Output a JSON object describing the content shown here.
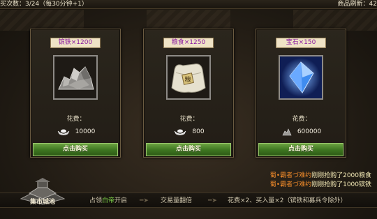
{
  "topbar": {
    "left_text": "买次数：3/24（每30分钟+1）",
    "right_text": "商品刷新：42"
  },
  "items": [
    {
      "name": "镔铁×1200",
      "image": "iron-ore-icon",
      "cost_label": "花费：",
      "currency_icon": "silver-ingot-icon",
      "price": "10000",
      "buy_label": "点击购买"
    },
    {
      "name": "粮食×1250",
      "image": "grain-sack-icon",
      "cost_label": "花费：",
      "currency_icon": "silver-ingot-icon",
      "price": "800",
      "buy_label": "点击购买"
    },
    {
      "name": "宝石×150",
      "image": "blue-gem-icon",
      "cost_label": "花费：",
      "currency_icon": "ore-pile-icon",
      "price": "600000",
      "buy_label": "点击购买"
    }
  ],
  "messages": [
    {
      "player": "蜀•霸者づ难约",
      "text": "刚刚抢购了2000粮食"
    },
    {
      "player": "蜀•霸者づ难约",
      "text": "刚刚抢购了1000镔铁"
    }
  ],
  "bottom": {
    "city_label": "集市城池",
    "step1_prefix": "占领",
    "step1_highlight": "白帝",
    "step1_suffix": "开启",
    "step2": "交易量翻倍",
    "step3": "花费×2、买入量×2（镔铁和募兵令除外）"
  },
  "colors": {
    "item_title": "#8a1aa0",
    "buy_button": "#3c7420",
    "player_name": "#f08a2a",
    "highlight_city": "#7fd84a"
  }
}
